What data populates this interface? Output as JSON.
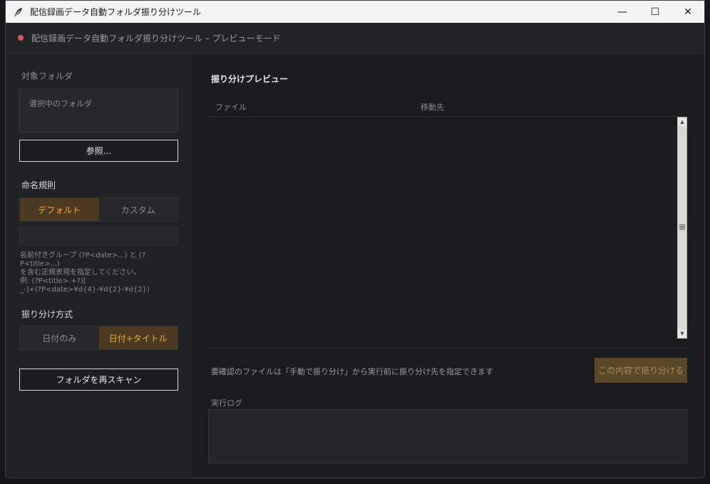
{
  "window": {
    "title": "配信録画データ自動フォルダ振り分けツール",
    "controls": {
      "minimize": "—",
      "maximize": "☐",
      "close": "✕"
    }
  },
  "header": {
    "status_color": "#e05555",
    "text": "配信録画データ自動フォルダ振り分けツール – プレビューモード"
  },
  "sidebar": {
    "target_folder_label": "対象フォルダ",
    "folder_placeholder": "選択中のフォルダ",
    "browse_label": "参照...",
    "naming_label": "命名規則",
    "naming_options": [
      {
        "label": "デフォルト",
        "selected": true
      },
      {
        "label": "カスタム",
        "selected": false
      }
    ],
    "regex_value": "",
    "help_text": "名前付きグループ (?P<date>...) と (?P<title>...)\nを含む正規表現を指定してください。\n例: (?P<title>.+?)[\n_-]+(?P<date>¥d{4}-¥d{2}-¥d{2})",
    "sort_label": "振り分け方式",
    "sort_options": [
      {
        "label": "日付のみ",
        "selected": false
      },
      {
        "label": "日付+タイトル",
        "selected": true
      }
    ],
    "rescan_label": "フォルダを再スキャン"
  },
  "main": {
    "preview_title": "振り分けプレビュー",
    "columns": [
      "ファイル",
      "移動先"
    ],
    "rows": [],
    "note": "要確認のファイルは「手動で振り分け」から実行前に振り分け先を指定できます",
    "run_label": "この内容で振り分ける",
    "log_label": "実行ログ",
    "log_text": ""
  },
  "colors": {
    "accent": "#f0a93a",
    "accent_bg": "#4c3b22",
    "background": "#1b1c1f"
  }
}
